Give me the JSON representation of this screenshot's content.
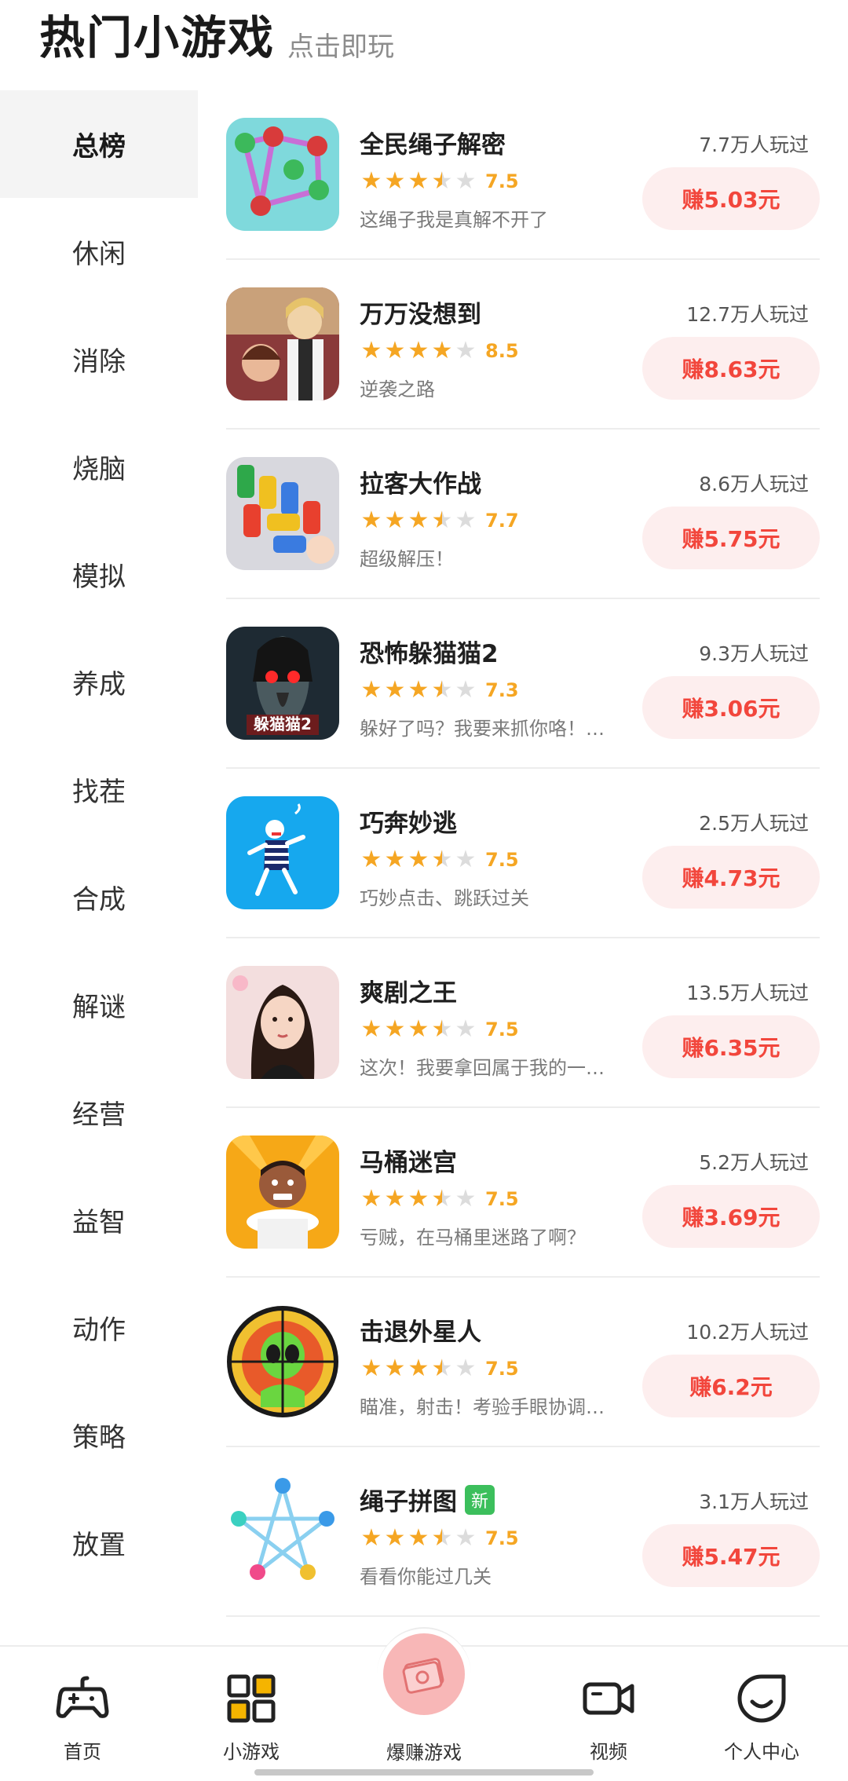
{
  "header": {
    "title": "热门小游戏",
    "subtitle": "点击即玩"
  },
  "sidebar": {
    "items": [
      {
        "label": "总榜",
        "active": true
      },
      {
        "label": "休闲"
      },
      {
        "label": "消除"
      },
      {
        "label": "烧脑"
      },
      {
        "label": "模拟"
      },
      {
        "label": "养成"
      },
      {
        "label": "找茬"
      },
      {
        "label": "合成"
      },
      {
        "label": "解谜"
      },
      {
        "label": "经营"
      },
      {
        "label": "益智"
      },
      {
        "label": "动作"
      },
      {
        "label": "策略"
      },
      {
        "label": "放置"
      }
    ]
  },
  "games": [
    {
      "name": "全民绳子解密",
      "score": "7.5",
      "rating": 3.5,
      "desc": "这绳子我是真解不开了",
      "players": "7.7万人玩过",
      "earn": "赚5.03元",
      "badge": "",
      "icon": "rope-puzzle-icon"
    },
    {
      "name": "万万没想到",
      "score": "8.5",
      "rating": 4,
      "desc": "逆袭之路",
      "players": "12.7万人玩过",
      "earn": "赚8.63元",
      "badge": "",
      "icon": "drama-characters-icon"
    },
    {
      "name": "拉客大作战",
      "score": "7.7",
      "rating": 3.5,
      "desc": "超级解压！",
      "players": "8.6万人玩过",
      "earn": "赚5.75元",
      "badge": "",
      "icon": "parking-cars-icon"
    },
    {
      "name": "恐怖躲猫猫2",
      "score": "7.3",
      "rating": 3.5,
      "desc": "躲好了吗？我要来抓你咯！…",
      "players": "9.3万人玩过",
      "earn": "赚3.06元",
      "badge": "",
      "icon": "horror-mask-icon"
    },
    {
      "name": "巧奔妙逃",
      "score": "7.5",
      "rating": 3.5,
      "desc": "巧妙点击、跳跃过关",
      "players": "2.5万人玩过",
      "earn": "赚4.73元",
      "badge": "",
      "icon": "running-prisoner-icon"
    },
    {
      "name": "爽剧之王",
      "score": "7.5",
      "rating": 3.5,
      "desc": "这次！我要拿回属于我的一…",
      "players": "13.5万人玩过",
      "earn": "赚6.35元",
      "badge": "",
      "icon": "drama-girl-icon"
    },
    {
      "name": "马桶迷宫",
      "score": "7.5",
      "rating": 3.5,
      "desc": "亏贼，在马桶里迷路了啊？",
      "players": "5.2万人玩过",
      "earn": "赚3.69元",
      "badge": "",
      "icon": "toilet-man-icon"
    },
    {
      "name": "击退外星人",
      "score": "7.5",
      "rating": 3.5,
      "desc": "瞄准，射击！考验手眼协调…",
      "players": "10.2万人玩过",
      "earn": "赚6.2元",
      "badge": "",
      "icon": "alien-target-icon"
    },
    {
      "name": "绳子拼图",
      "score": "7.5",
      "rating": 3.5,
      "desc": "看看你能过几关",
      "players": "3.1万人玩过",
      "earn": "赚5.47元",
      "badge": "新",
      "icon": "rope-star-icon"
    }
  ],
  "bottom_nav": [
    {
      "label": "首页",
      "icon": "gamepad-icon"
    },
    {
      "label": "小游戏",
      "icon": "grid-icon"
    },
    {
      "label": "爆赚游戏",
      "icon": "money-stack-icon"
    },
    {
      "label": "视频",
      "icon": "video-camera-icon"
    },
    {
      "label": "个人中心",
      "icon": "smiley-face-icon"
    }
  ],
  "colors": {
    "accent_red": "#f2463c",
    "star": "#f5a623",
    "earn_bg": "#fdeeee",
    "new_badge": "#3cbf5c"
  }
}
